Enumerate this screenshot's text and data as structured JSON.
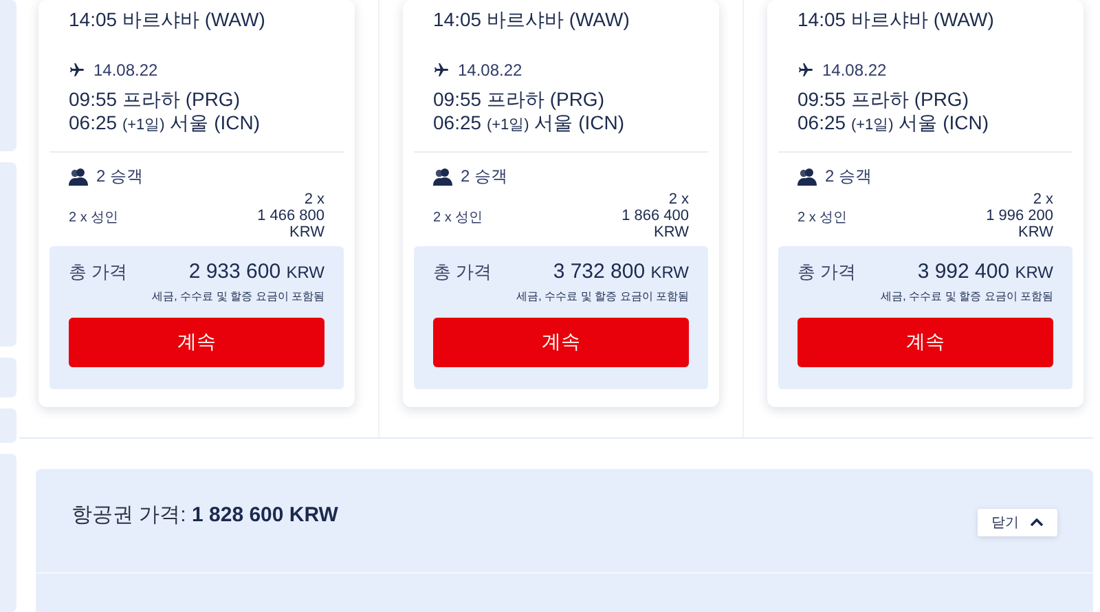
{
  "offers": [
    {
      "outbound_arrival": "14:05 바르샤바 (WAW)",
      "return_flight": {
        "date": "14.08.22",
        "departure": "09:55 프라하 (PRG)",
        "arrival_time": "06:25",
        "arrival_day_offset": "(+1일)",
        "arrival_place": "서울 (ICN)"
      },
      "passengers": "2 승객",
      "fare": {
        "label": "2 x 성인",
        "multiplier": "2 x",
        "amount": "1 466 800",
        "currency": "KRW"
      },
      "total": {
        "label": "총 가격",
        "amount": "2 933 600",
        "currency": "KRW",
        "note": "세금, 수수료 및 할증 요금이 포함됨"
      },
      "button": "계속"
    },
    {
      "outbound_arrival": "14:05 바르샤바 (WAW)",
      "return_flight": {
        "date": "14.08.22",
        "departure": "09:55 프라하 (PRG)",
        "arrival_time": "06:25",
        "arrival_day_offset": "(+1일)",
        "arrival_place": "서울 (ICN)"
      },
      "passengers": "2 승객",
      "fare": {
        "label": "2 x 성인",
        "multiplier": "2 x",
        "amount": "1 866 400",
        "currency": "KRW"
      },
      "total": {
        "label": "총 가격",
        "amount": "3 732 800",
        "currency": "KRW",
        "note": "세금, 수수료 및 할증 요금이 포함됨"
      },
      "button": "계속"
    },
    {
      "outbound_arrival": "14:05 바르샤바 (WAW)",
      "return_flight": {
        "date": "14.08.22",
        "departure": "09:55 프라하 (PRG)",
        "arrival_time": "06:25",
        "arrival_day_offset": "(+1일)",
        "arrival_place": "서울 (ICN)"
      },
      "passengers": "2 승객",
      "fare": {
        "label": "2 x 성인",
        "multiplier": "2 x",
        "amount": "1 996 200",
        "currency": "KRW"
      },
      "total": {
        "label": "총 가격",
        "amount": "3 992 400",
        "currency": "KRW",
        "note": "세금, 수수료 및 할증 요금이 포함됨"
      },
      "button": "계속"
    }
  ],
  "ticket_price": {
    "text": "항공권 가격: **1 828 600 KRW**",
    "close_button": "닫기"
  }
}
